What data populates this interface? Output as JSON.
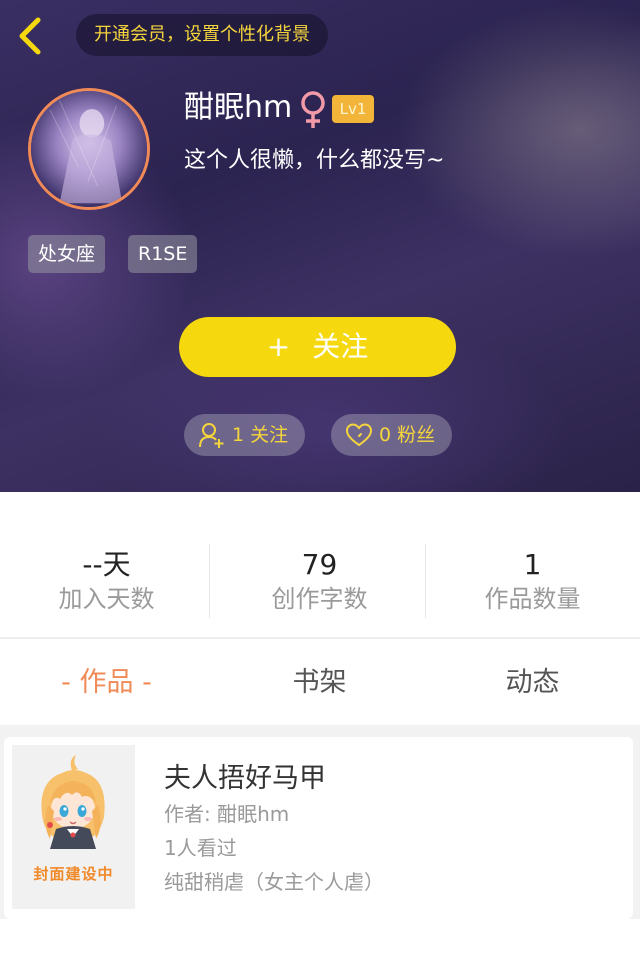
{
  "header": {
    "vip_prompt": "开通会员，设置个性化背景"
  },
  "profile": {
    "name": "酣眠hm",
    "level": "Lv1",
    "bio": "这个人很懒，什么都没写~",
    "tags": [
      "处女座",
      "R1SE"
    ],
    "follow_plus": "+",
    "follow_label": "关注",
    "following_text": "1 关注",
    "followers_text": "0 粉丝"
  },
  "stats": [
    {
      "value": "--天",
      "label": "加入天数"
    },
    {
      "value": "79",
      "label": "创作字数"
    },
    {
      "value": "1",
      "label": "作品数量"
    }
  ],
  "tabs": [
    "- 作品 -",
    "书架",
    "动态"
  ],
  "works": [
    {
      "cover_label": "封面建设中",
      "title": "夫人捂好马甲",
      "author": "作者: 酣眠hm",
      "views": "1人看过",
      "tags": "纯甜稍虐（女主个人虐）"
    }
  ],
  "colors": {
    "accent_yellow": "#f6d80e",
    "accent_orange": "#f08a57",
    "pill_text": "#f5d53c",
    "level_badge": "#f3b43a"
  }
}
